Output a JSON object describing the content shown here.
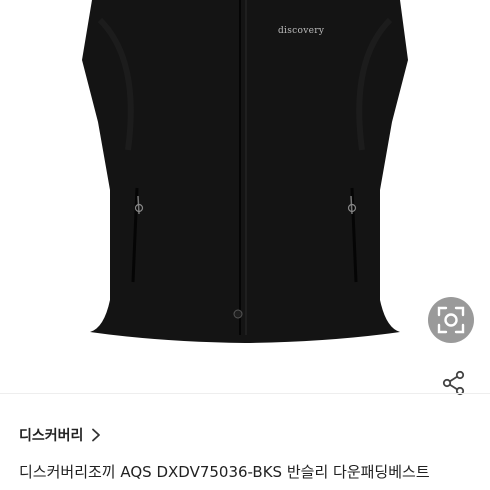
{
  "product_image": {
    "logo_text": "discovery",
    "lens_icon": "camera-lens-icon",
    "share_icon": "share-icon"
  },
  "brand": {
    "name": "디스커버리",
    "chevron_icon": "chevron-right-icon"
  },
  "product": {
    "title": "디스커버리조끼 AQS DXDV75036-BKS 반슬리 다운패딩베스트"
  },
  "colors": {
    "vest": "#141414",
    "lens_bg": "#9a9a9a",
    "text": "#222222"
  }
}
